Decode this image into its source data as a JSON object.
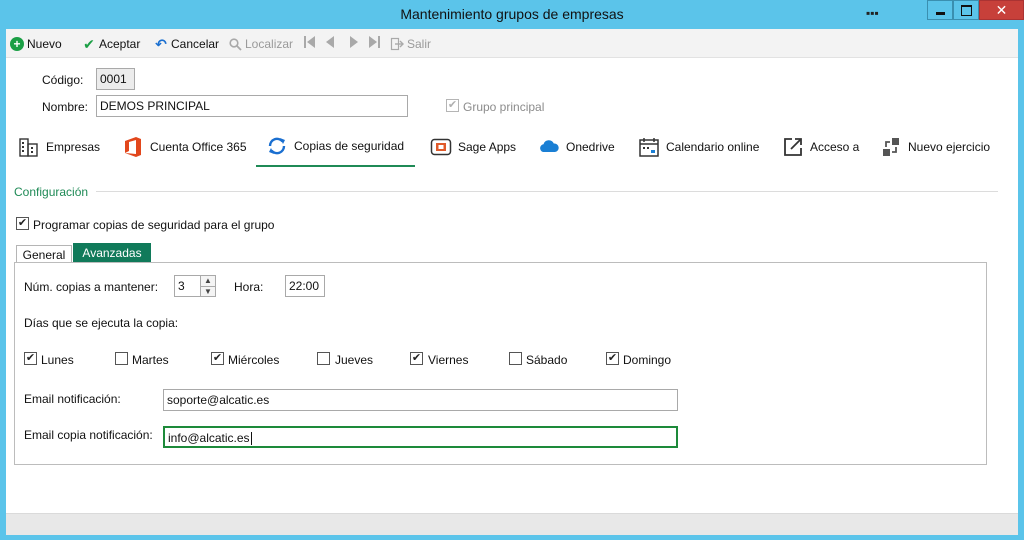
{
  "window": {
    "title": "Mantenimiento grupos de empresas",
    "dots": "▪▪▪",
    "close_glyph": "✕"
  },
  "toolbar": {
    "nuevo": "Nuevo",
    "aceptar": "Aceptar",
    "cancelar": "Cancelar",
    "localizar": "Localizar",
    "salir": "Salir"
  },
  "form": {
    "codigo_label": "Código:",
    "codigo_value": "0001",
    "nombre_label": "Nombre:",
    "nombre_value": "DEMOS PRINCIPAL",
    "grupo_principal_label": "Grupo principal"
  },
  "tabs": [
    {
      "label": "Empresas",
      "icon": "building-icon"
    },
    {
      "label": "Cuenta Office 365",
      "icon": "office-icon"
    },
    {
      "label": "Copias de seguridad",
      "icon": "sync-icon"
    },
    {
      "label": "Sage Apps",
      "icon": "apps-icon"
    },
    {
      "label": "Onedrive",
      "icon": "cloud-icon"
    },
    {
      "label": "Calendario online",
      "icon": "calendar-icon"
    },
    {
      "label": "Acceso a",
      "icon": "external-link-icon"
    },
    {
      "label": "Nuevo ejercicio",
      "icon": "transfer-icon"
    }
  ],
  "config": {
    "section_title": "Configuración",
    "programar_label": "Programar copias de seguridad para el grupo",
    "subtabs": {
      "general": "General",
      "avanzadas": "Avanzadas"
    },
    "num_copias_label": "Núm. copias a mantener:",
    "num_copias_value": "3",
    "hora_label": "Hora:",
    "hora_value": "22:00",
    "dias_label": "Días que se ejecuta la copia:",
    "days": [
      {
        "label": "Lunes",
        "checked": true
      },
      {
        "label": "Martes",
        "checked": false
      },
      {
        "label": "Miércoles",
        "checked": true
      },
      {
        "label": "Jueves",
        "checked": false
      },
      {
        "label": "Viernes",
        "checked": true
      },
      {
        "label": "Sábado",
        "checked": false
      },
      {
        "label": "Domingo",
        "checked": true
      }
    ],
    "email_label": "Email notificación:",
    "email_value": "soporte@alcatic.es",
    "email_copia_label": "Email copia notificación:",
    "email_copia_value": "info@alcatic.es"
  },
  "colors": {
    "accent_green": "#1f8a56",
    "subtab_active": "#107a5a",
    "titlebar": "#5bc4ea",
    "close_red": "#c7403a"
  }
}
